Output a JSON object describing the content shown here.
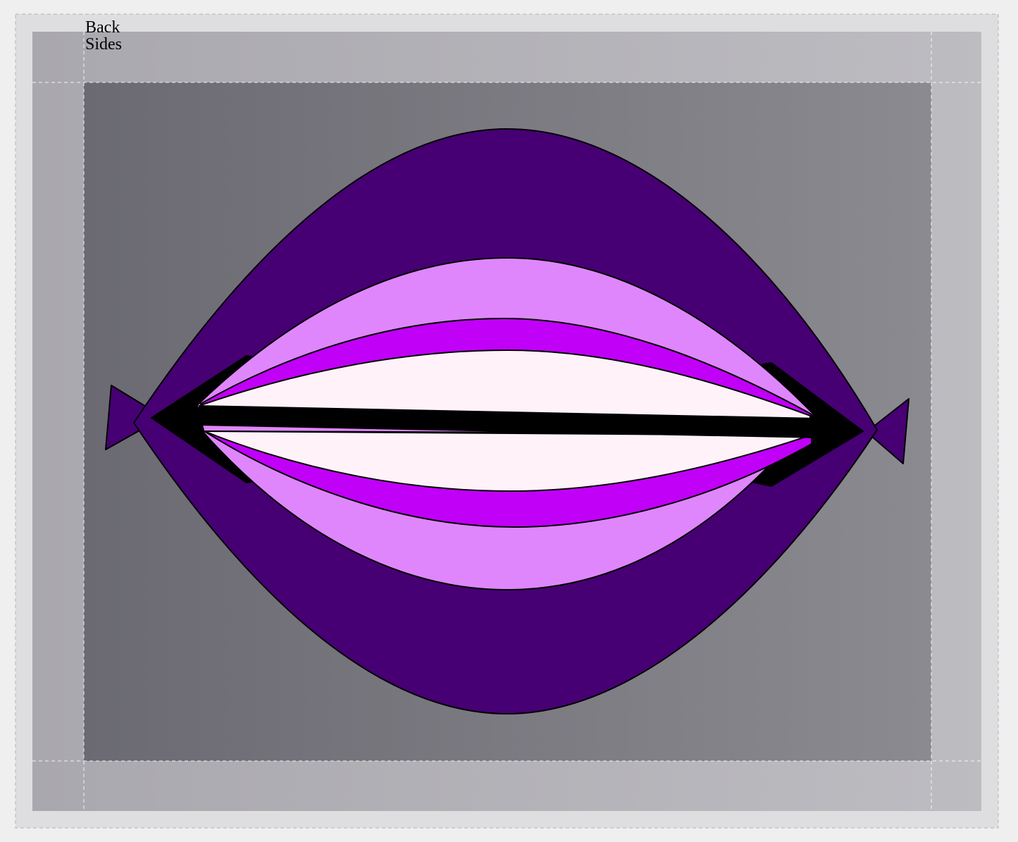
{
  "labels": {
    "back": "Back",
    "sides": "Sides"
  },
  "colors": {
    "page_background": "#efefef",
    "frame_outer": "#dedee0",
    "frame_band": "#b3b2b8",
    "panel": "#7c7b82",
    "guide_line": "#ffffff",
    "deep_purple": "#460073",
    "lavender": "#df86fd",
    "magenta": "#c100f8",
    "blush_white": "#fff2f9",
    "black": "#000000"
  }
}
